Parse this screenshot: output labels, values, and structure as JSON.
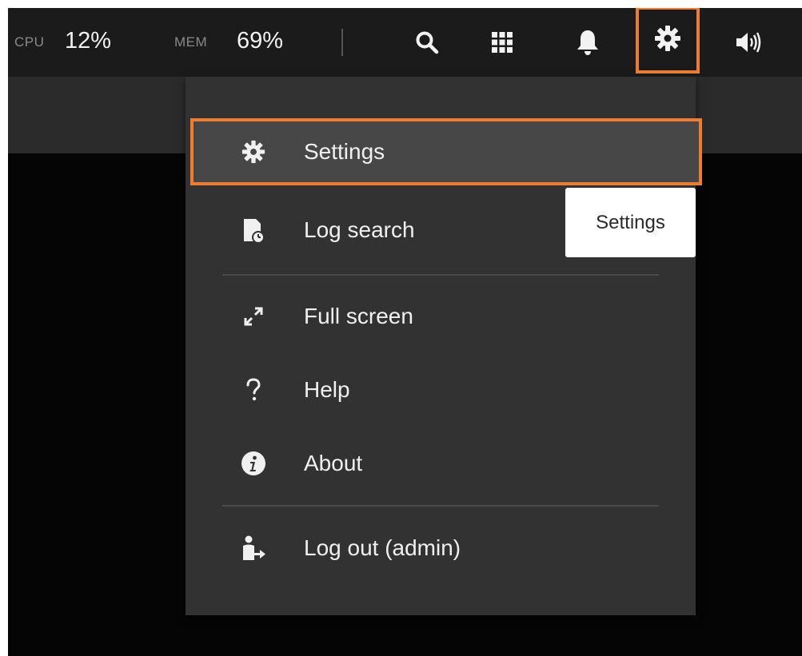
{
  "topbar": {
    "cpu_label": "CPU",
    "cpu_value": "12%",
    "mem_label": "MEM",
    "mem_value": "69%",
    "icons": [
      "search-icon",
      "grid-icon",
      "bell-icon",
      "gear-icon",
      "speaker-icon"
    ]
  },
  "menu": {
    "items": [
      {
        "label": "Settings",
        "icon": "gear-icon",
        "selected": true
      },
      {
        "label": "Log search",
        "icon": "log-search-icon"
      },
      {
        "label": "Full screen",
        "icon": "fullscreen-icon"
      },
      {
        "label": "Help",
        "icon": "help-icon"
      },
      {
        "label": "About",
        "icon": "info-icon"
      },
      {
        "label": "Log out (admin)",
        "icon": "logout-icon"
      }
    ]
  },
  "tooltip": {
    "text": "Settings"
  },
  "colors": {
    "highlight": "#ee7d30",
    "topbar_bg": "#1b1b1b",
    "menu_bg": "#323232",
    "selected_bg": "#474747"
  }
}
